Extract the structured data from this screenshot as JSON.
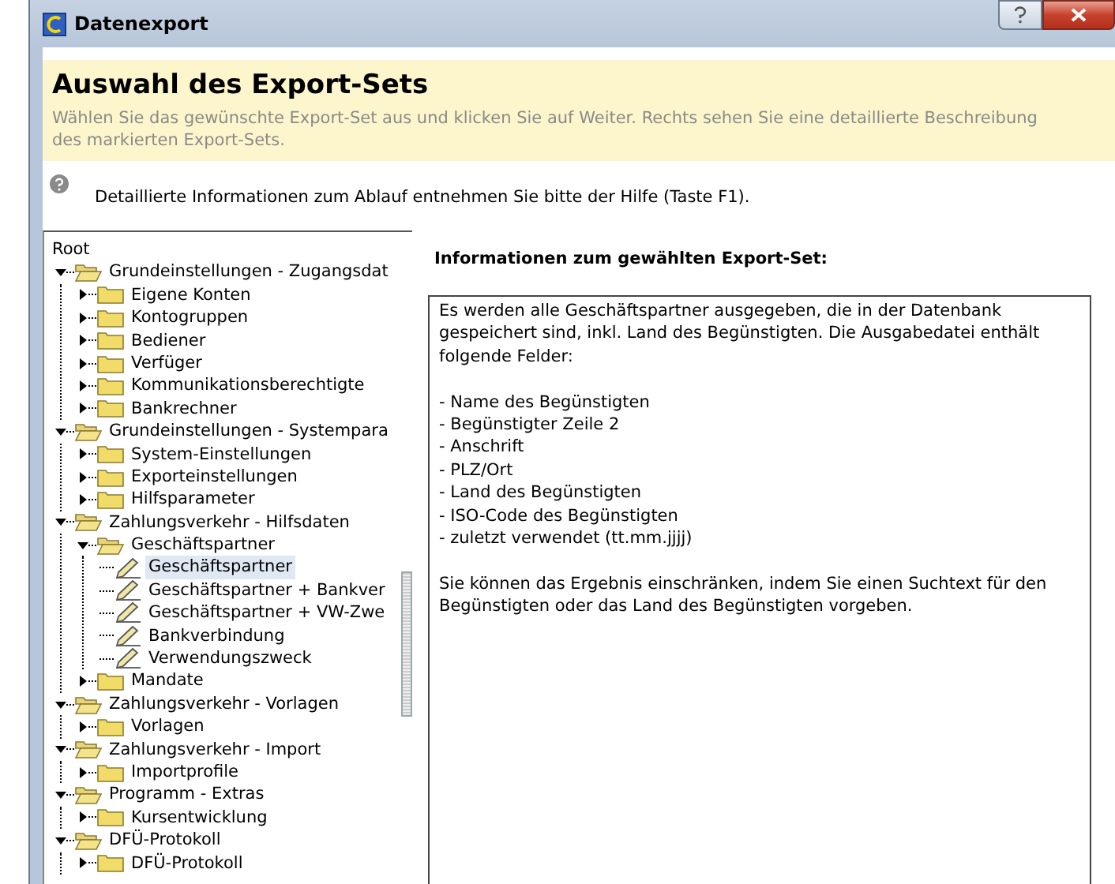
{
  "window": {
    "title": "Datenexport"
  },
  "header": {
    "title": "Auswahl des Export-Sets",
    "subtitle": "Wählen Sie das gewünschte Export-Set aus und klicken Sie auf Weiter. Rechts sehen Sie eine detaillierte Beschreibung des markierten Export-Sets."
  },
  "help_text": "Detaillierte Informationen zum Ablauf entnehmen Sie bitte der Hilfe (Taste F1).",
  "tree": {
    "root": "Root",
    "items": [
      {
        "label": "Grundeinstellungen - Zugangsdat",
        "kind": "folder",
        "expanded": true,
        "selected": false,
        "children": [
          {
            "label": "Eigene Konten",
            "kind": "folder",
            "expanded": false,
            "selected": false
          },
          {
            "label": "Kontogruppen",
            "kind": "folder",
            "expanded": false,
            "selected": false
          },
          {
            "label": "Bediener",
            "kind": "folder",
            "expanded": false,
            "selected": false
          },
          {
            "label": "Verfüger",
            "kind": "folder",
            "expanded": false,
            "selected": false
          },
          {
            "label": "Kommunikationsberechtigte",
            "kind": "folder",
            "expanded": false,
            "selected": false
          },
          {
            "label": "Bankrechner",
            "kind": "folder",
            "expanded": false,
            "selected": false
          }
        ]
      },
      {
        "label": "Grundeinstellungen - Systempara",
        "kind": "folder",
        "expanded": true,
        "selected": false,
        "children": [
          {
            "label": "System-Einstellungen",
            "kind": "folder",
            "expanded": false,
            "selected": false
          },
          {
            "label": "Exporteinstellungen",
            "kind": "folder",
            "expanded": false,
            "selected": false
          },
          {
            "label": "Hilfsparameter",
            "kind": "folder",
            "expanded": false,
            "selected": false
          }
        ]
      },
      {
        "label": "Zahlungsverkehr - Hilfsdaten",
        "kind": "folder",
        "expanded": true,
        "selected": false,
        "children": [
          {
            "label": "Geschäftspartner",
            "kind": "folder",
            "expanded": true,
            "selected": false,
            "children": [
              {
                "label": "Geschäftspartner",
                "kind": "document",
                "selected": true
              },
              {
                "label": "Geschäftspartner + Bankver",
                "kind": "document",
                "selected": false
              },
              {
                "label": "Geschäftspartner + VW-Zwe",
                "kind": "document",
                "selected": false
              },
              {
                "label": "Bankverbindung",
                "kind": "document",
                "selected": false
              },
              {
                "label": "Verwendungszweck",
                "kind": "document",
                "selected": false
              }
            ]
          },
          {
            "label": "Mandate",
            "kind": "folder",
            "expanded": false,
            "selected": false
          }
        ]
      },
      {
        "label": "Zahlungsverkehr - Vorlagen",
        "kind": "folder",
        "expanded": true,
        "selected": false,
        "children": [
          {
            "label": "Vorlagen",
            "kind": "folder",
            "expanded": false,
            "selected": false
          }
        ]
      },
      {
        "label": "Zahlungsverkehr - Import",
        "kind": "folder",
        "expanded": true,
        "selected": false,
        "children": [
          {
            "label": "Importprofile",
            "kind": "folder",
            "expanded": false,
            "selected": false
          }
        ]
      },
      {
        "label": "Programm - Extras",
        "kind": "folder",
        "expanded": true,
        "selected": false,
        "children": [
          {
            "label": "Kursentwicklung",
            "kind": "folder",
            "expanded": false,
            "selected": false
          }
        ]
      },
      {
        "label": "DFÜ-Protokoll",
        "kind": "folder",
        "expanded": true,
        "selected": false,
        "children": [
          {
            "label": "DFÜ-Protokoll",
            "kind": "folder",
            "expanded": false,
            "selected": false
          }
        ]
      }
    ]
  },
  "info": {
    "heading": "Informationen zum gewählten Export-Set:",
    "intro": "Es werden alle Geschäftspartner ausgegeben, die in der Datenbank gespeichert sind, inkl. Land des Begünstigten. Die Ausgabedatei enthält folgende Felder:",
    "fields": [
      "- Name des Begünstigten",
      "- Begünstigter Zeile 2",
      "- Anschrift",
      "- PLZ/Ort",
      "- Land des Begünstigten",
      "- ISO-Code des Begünstigten",
      "- zuletzt verwendet (tt.mm.jjjj)"
    ],
    "note": "Sie können das Ergebnis einschränken, indem Sie einen Suchtext für den Begünstigten oder das Land des Begünstigten vorgeben."
  }
}
